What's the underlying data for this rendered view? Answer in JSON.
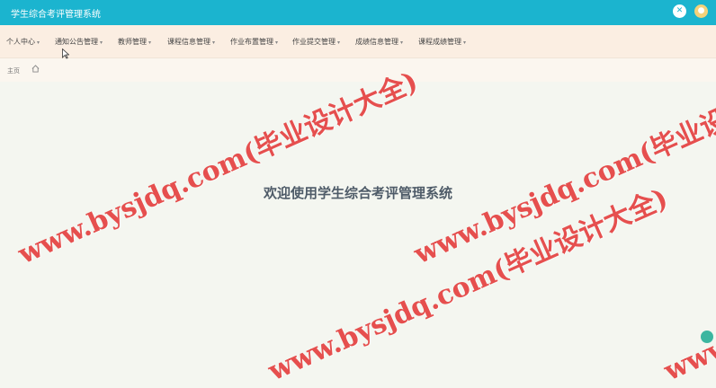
{
  "header": {
    "title": "学生综合考评管理系统",
    "close_icon": "close-icon",
    "user_icon": "user-icon"
  },
  "nav": {
    "items": [
      {
        "label": "个人中心"
      },
      {
        "label": "通知公告管理"
      },
      {
        "label": "教师管理"
      },
      {
        "label": "课程信息管理"
      },
      {
        "label": "作业布置管理"
      },
      {
        "label": "作业提交管理"
      },
      {
        "label": "成绩信息管理"
      },
      {
        "label": "课程成绩管理"
      }
    ]
  },
  "breadcrumb": {
    "home_label": "主页",
    "home_icon": "home-icon"
  },
  "main": {
    "welcome_text": "欢迎使用学生综合考评管理系统"
  },
  "watermark": {
    "text": "www.bysjdq.com(毕业设计大全)"
  },
  "colors": {
    "header_bg": "#1bb4cf",
    "nav_bg": "#fbeee2",
    "watermark": "#e02828"
  }
}
